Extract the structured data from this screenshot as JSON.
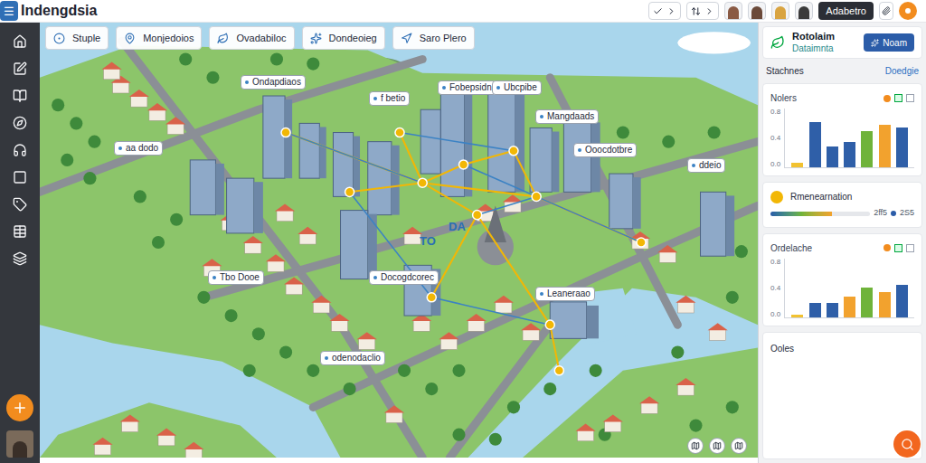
{
  "app": {
    "title": "Indengdsia",
    "menu_icon": "☰"
  },
  "toolbar": {
    "user_button": "Adabetro",
    "avatars": [
      {
        "color": "#8a5a44"
      },
      {
        "color": "#6b4a3a"
      },
      {
        "color": "#d9a441"
      },
      {
        "color": "#3b3b3b"
      }
    ]
  },
  "tabs": [
    {
      "label": "Stuple"
    },
    {
      "label": "Monjedoios"
    },
    {
      "label": "Ovadabiloc"
    },
    {
      "label": "Dondeoieg"
    },
    {
      "label": "Saro Plero"
    }
  ],
  "map": {
    "labels": [
      "Ondapdiaos",
      "f betio",
      "Fobepsidn",
      "Ubcpibe",
      "Mangdaads",
      "aa dodo",
      "Ooocdotbre",
      "ddeio",
      "Tbo Dooe",
      "Docogdcorec",
      "Leaneraao",
      "odenodaclio"
    ],
    "overlay_text": [
      "TO",
      "DA"
    ]
  },
  "panel": {
    "header": {
      "title": "Rotolaim",
      "subtitle": "Dataimnta",
      "button": "Noam"
    },
    "section": {
      "title": "Stachnes",
      "link": "Doedgie"
    },
    "chart1": {
      "title": "Nolers",
      "ticks": [
        "0.8",
        "0.4",
        "0.0"
      ],
      "bars": [
        {
          "value": 0.08,
          "color": "#f2c230"
        },
        {
          "value": 0.78,
          "color": "#2f5fa8"
        },
        {
          "value": 0.36,
          "color": "#2f5fa8"
        },
        {
          "value": 0.44,
          "color": "#2f5fa8"
        },
        {
          "value": 0.62,
          "color": "#6fb33a"
        },
        {
          "value": 0.72,
          "color": "#f2a22e"
        },
        {
          "value": 0.68,
          "color": "#2f5fa8"
        }
      ]
    },
    "progress": {
      "title": "Rmenearnation",
      "level": 0.62,
      "left_reading": "2ff5",
      "right_reading": "2S5"
    },
    "chart2": {
      "title": "Ordelache",
      "ticks": [
        "0.8",
        "0.4",
        "0.0"
      ],
      "bars": [
        {
          "value": 0.05,
          "color": "#f2c230"
        },
        {
          "value": 0.25,
          "color": "#2f5fa8"
        },
        {
          "value": 0.25,
          "color": "#2f5fa8"
        },
        {
          "value": 0.35,
          "color": "#f2a22e"
        },
        {
          "value": 0.5,
          "color": "#6fb33a"
        },
        {
          "value": 0.42,
          "color": "#f2a22e"
        },
        {
          "value": 0.55,
          "color": "#2f5fa8"
        }
      ]
    },
    "bottom_card": {
      "title": "Ooles"
    }
  }
}
